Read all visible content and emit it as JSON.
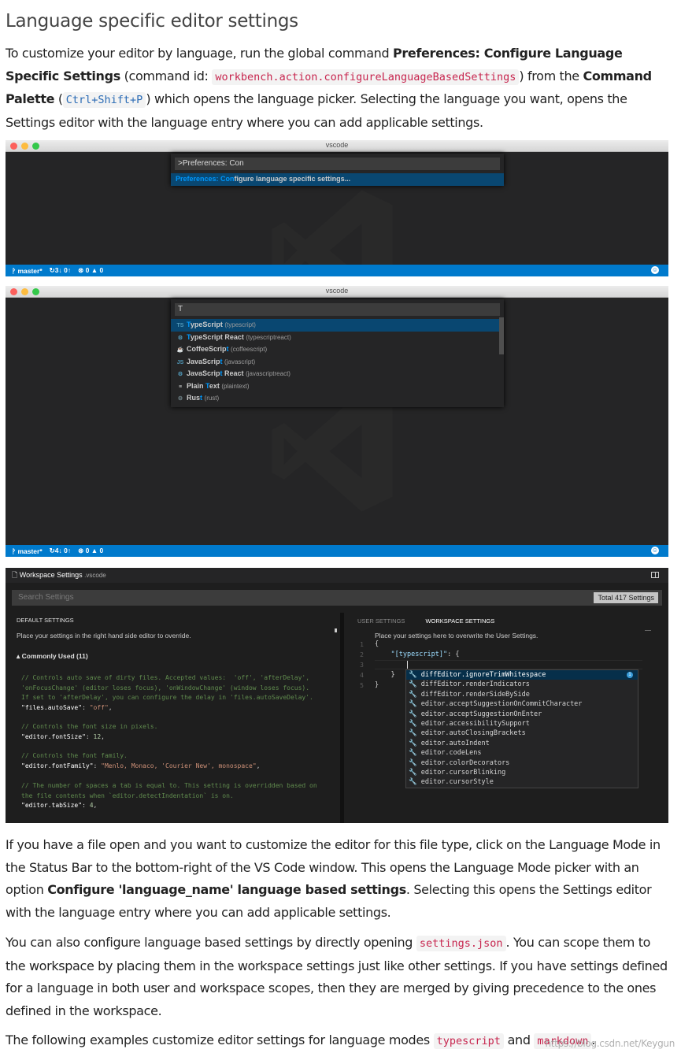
{
  "page": {
    "title": "Language specific editor settings"
  },
  "para1": {
    "t1": "To customize your editor by language, run the global command ",
    "b1": "Preferences: Configure Language Specific Settings",
    "t2": " (command id: ",
    "code1": "workbench.action.configureLanguageBasedSettings",
    "t3": ") from the ",
    "b2": "Command Palette",
    "t4": " (",
    "code2": "Ctrl+Shift+P",
    "t5": ") which opens the language picker. Selecting the language you want, opens the Settings editor with the language entry where you can add applicable settings."
  },
  "shot1": {
    "window_title": "vscode",
    "input_value": ">Preferences: Con",
    "item_prefix": "Preferences: ",
    "item_match": "Con",
    "item_rest": "figure language specific settings...",
    "status": {
      "branch": "master*",
      "sync": "3↓ 0↑",
      "errors": "0",
      "warnings": "0"
    }
  },
  "shot2": {
    "window_title": "vscode",
    "input_value": "T",
    "items": [
      {
        "icon": "TS",
        "pre": "",
        "match": "T",
        "rest": "ypeScript",
        "id": "(typescript)"
      },
      {
        "icon": "⚙",
        "pre": "",
        "match": "T",
        "rest": "ypeScript React",
        "id": "(typescriptreact)"
      },
      {
        "icon": "☕",
        "pre": "CoffeeScrip",
        "match": "t",
        "rest": "",
        "id": "(coffeescript)"
      },
      {
        "icon": "JS",
        "pre": "JavaScrip",
        "match": "t",
        "rest": "",
        "id": "(javascript)"
      },
      {
        "icon": "⚙",
        "pre": "JavaScrip",
        "match": "t",
        "rest": " React",
        "id": "(javascriptreact)"
      },
      {
        "icon": "≡",
        "pre": "Plain ",
        "match": "T",
        "rest": "ext",
        "id": "(plaintext)"
      },
      {
        "icon": "⚙",
        "pre": "Rus",
        "match": "t",
        "rest": "",
        "id": "(rust)"
      }
    ],
    "status": {
      "branch": "master*",
      "sync": "4↓ 0↑",
      "errors": "0",
      "warnings": "0"
    }
  },
  "shot3": {
    "tab_title": "Workspace Settings",
    "tab_sub": ".vscode",
    "search_placeholder": "Search Settings",
    "total": "Total 417 Settings",
    "left_header": "DEFAULT SETTINGS",
    "left_hint": "Place your settings in the right hand side editor to override.",
    "common": "▴ Commonly Used (11)",
    "block1_c1": "// Controls auto save of dirty files. Accepted values:  'off', 'afterDelay',",
    "block1_c2": "'onFocusChange' (editor loses focus), 'onWindowChange' (window loses focus).",
    "block1_c3": "If set to 'afterDelay', you can configure the delay in 'files.autoSaveDelay'.",
    "block1_k": "\"files.autoSave\"",
    "block1_v": "\"off\"",
    "block2_c1": "// Controls the font size in pixels.",
    "block2_k": "\"editor.fontSize\"",
    "block2_v": "12",
    "block3_c1": "// Controls the font family.",
    "block3_k": "\"editor.fontFamily\"",
    "block3_v": "\"Menlo, Monaco, 'Courier New', monospace\"",
    "block4_c1": "// The number of spaces a tab is equal to. This setting is overridden based on",
    "block4_c2": "the file contents when `editor.detectIndentation` is on.",
    "block4_k": "\"editor.tabSize\"",
    "block4_v": "4",
    "tab_user": "USER SETTINGS",
    "tab_workspace": "WORKSPACE SETTINGS",
    "right_hint": "Place your settings here to overwrite the User Settings.",
    "right_key": "\"[typescript]\"",
    "suggestions": [
      "diffEditor.ignoreTrimWhitespace",
      "diffEditor.renderIndicators",
      "diffEditor.renderSideBySide",
      "editor.acceptSuggestionOnCommitCharacter",
      "editor.acceptSuggestionOnEnter",
      "editor.accessibilitySupport",
      "editor.autoClosingBrackets",
      "editor.autoIndent",
      "editor.codeLens",
      "editor.colorDecorators",
      "editor.cursorBlinking",
      "editor.cursorStyle"
    ]
  },
  "para2": {
    "t1": "If you have a file open and you want to customize the editor for this file type, click on the Language Mode in the Status Bar to the bottom-right of the VS Code window. This opens the Language Mode picker with an option ",
    "b1": "Configure 'language_name' language based settings",
    "t2": ". Selecting this opens the Settings editor with the language entry where you can add applicable settings."
  },
  "para3": {
    "t1": "You can also configure language based settings by directly opening ",
    "code1": "settings.json",
    "t2": ". You can scope them to the workspace by placing them in the workspace settings just like other settings. If you have settings defined for a language in both user and workspace scopes, then they are merged by giving precedence to the ones defined in the workspace."
  },
  "para4": {
    "t1": "The following examples customize editor settings for language modes ",
    "code1": "typescript",
    "t2": " and ",
    "code2": "markdown",
    "t3": "."
  },
  "watermark": "https://blog.csdn.net/Keygun",
  "colors": {
    "status_blue": "#007acc",
    "selection": "#094771",
    "match": "#0097fb",
    "code_red": "#c7254e"
  }
}
